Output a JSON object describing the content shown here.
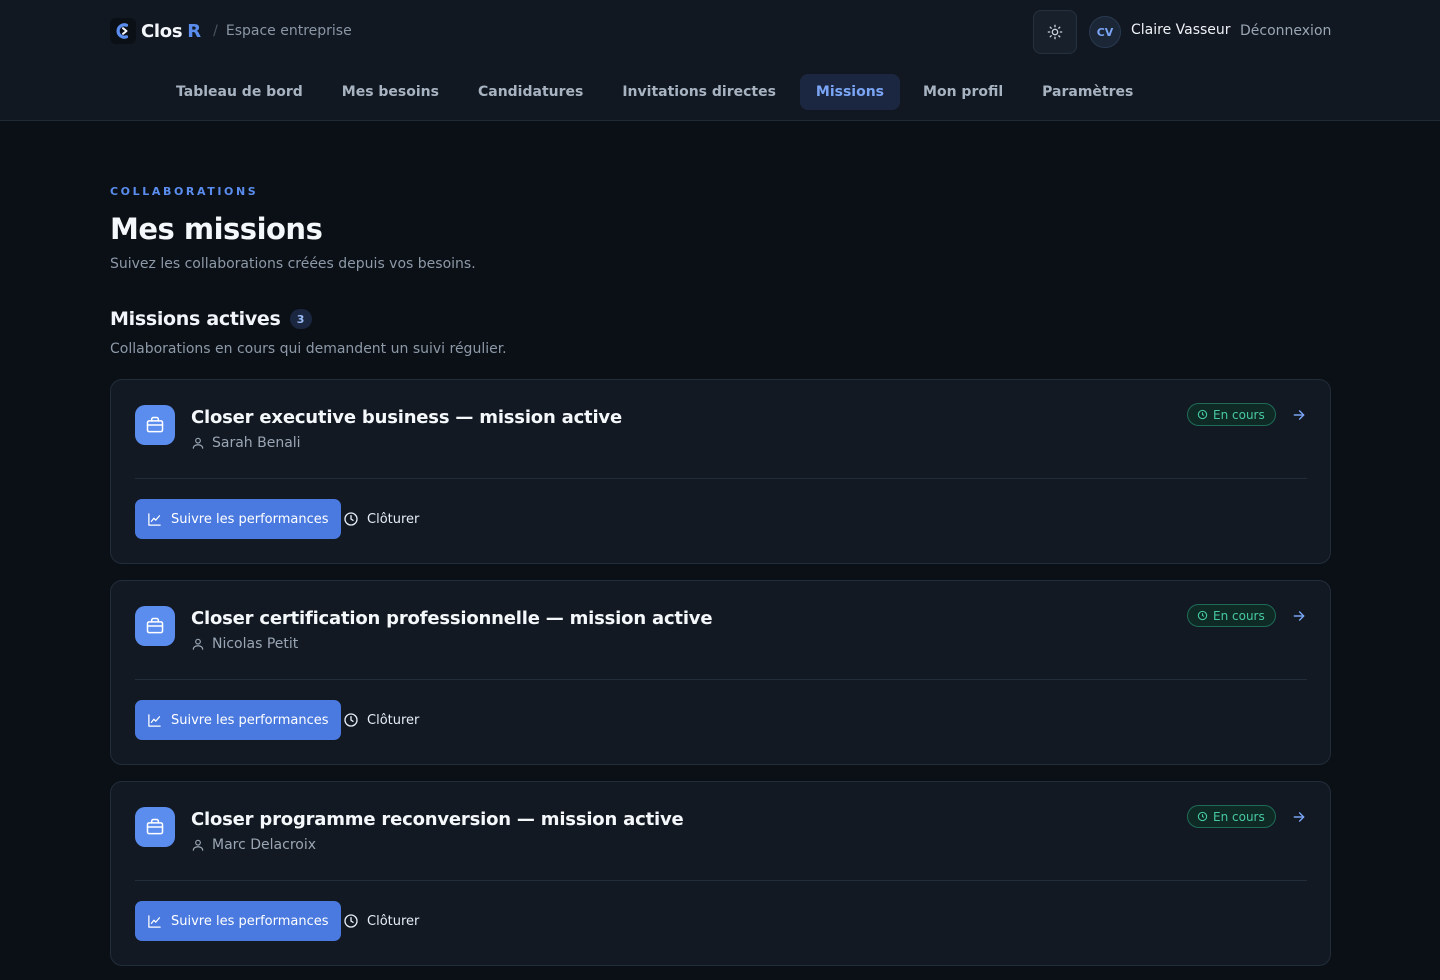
{
  "header": {
    "brand": {
      "name": "Clos",
      "accent": "R",
      "subtitle": "Espace entreprise",
      "separator": "/"
    },
    "user": {
      "initials": "CV",
      "name": "Claire Vasseur"
    },
    "logout_label": "Déconnexion",
    "theme_toggle_icon": "sun-icon"
  },
  "nav": {
    "items": [
      {
        "label": "Tableau de bord",
        "active": false
      },
      {
        "label": "Mes besoins",
        "active": false
      },
      {
        "label": "Candidatures",
        "active": false
      },
      {
        "label": "Invitations directes",
        "active": false
      },
      {
        "label": "Missions",
        "active": true
      },
      {
        "label": "Mon profil",
        "active": false
      },
      {
        "label": "Paramètres",
        "active": false
      }
    ]
  },
  "page": {
    "eyebrow": "COLLABORATIONS",
    "title": "Mes missions",
    "subtitle": "Suivez les collaborations créées depuis vos besoins."
  },
  "section": {
    "title": "Missions actives",
    "count": "3",
    "subtitle": "Collaborations en cours qui demandent un suivi régulier."
  },
  "missions": [
    {
      "title": "Closer executive business — mission active",
      "person": "Sarah Benali",
      "status": "En cours",
      "primary_action": "Suivre les performances",
      "secondary_action": "Clôturer"
    },
    {
      "title": "Closer certification professionnelle — mission active",
      "person": "Nicolas Petit",
      "status": "En cours",
      "primary_action": "Suivre les performances",
      "secondary_action": "Clôturer"
    },
    {
      "title": "Closer programme reconversion — mission active",
      "person": "Marc Delacroix",
      "status": "En cours",
      "primary_action": "Suivre les performances",
      "secondary_action": "Clôturer"
    }
  ],
  "colors": {
    "accent": "#5b8def",
    "primary_button": "#4a7ae0",
    "status_green": "#47c9a2",
    "background": "#0b1016",
    "card": "#121922"
  }
}
